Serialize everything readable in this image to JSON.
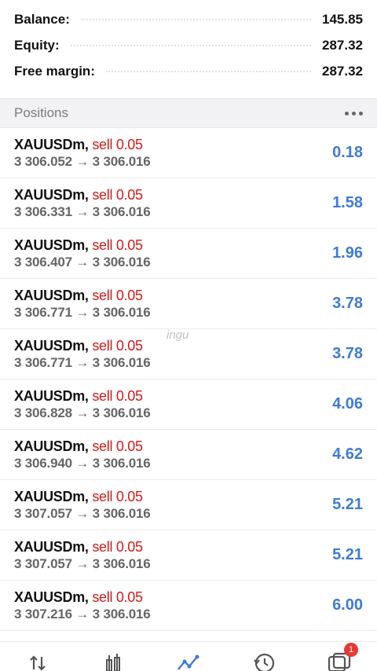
{
  "summary": [
    {
      "label": "Balance:",
      "value": "145.85"
    },
    {
      "label": "Equity:",
      "value": "287.32"
    },
    {
      "label": "Free margin:",
      "value": "287.32"
    }
  ],
  "positions_header": {
    "title": "Positions"
  },
  "positions": [
    {
      "symbol": "XAUUSDm,",
      "side": "sell 0.05",
      "prices": "3 306.052 → 3 306.016",
      "profit": "0.18"
    },
    {
      "symbol": "XAUUSDm,",
      "side": "sell 0.05",
      "prices": "3 306.331 → 3 306.016",
      "profit": "1.58"
    },
    {
      "symbol": "XAUUSDm,",
      "side": "sell 0.05",
      "prices": "3 306.407 → 3 306.016",
      "profit": "1.96"
    },
    {
      "symbol": "XAUUSDm,",
      "side": "sell 0.05",
      "prices": "3 306.771 → 3 306.016",
      "profit": "3.78"
    },
    {
      "symbol": "XAUUSDm,",
      "side": "sell 0.05",
      "prices": "3 306.771 → 3 306.016",
      "profit": "3.78"
    },
    {
      "symbol": "XAUUSDm,",
      "side": "sell 0.05",
      "prices": "3 306.828 → 3 306.016",
      "profit": "4.06"
    },
    {
      "symbol": "XAUUSDm,",
      "side": "sell 0.05",
      "prices": "3 306.940 → 3 306.016",
      "profit": "4.62"
    },
    {
      "symbol": "XAUUSDm,",
      "side": "sell 0.05",
      "prices": "3 307.057 → 3 306.016",
      "profit": "5.21"
    },
    {
      "symbol": "XAUUSDm,",
      "side": "sell 0.05",
      "prices": "3 307.057 → 3 306.016",
      "profit": "5.21"
    },
    {
      "symbol": "XAUUSDm,",
      "side": "sell 0.05",
      "prices": "3 307.216 → 3 306.016",
      "profit": "6.00"
    }
  ],
  "watermark": "ingu",
  "nav": {
    "items": [
      "quotes-icon",
      "chart-icon",
      "trade-icon",
      "history-icon",
      "messages-icon"
    ],
    "active_color": "#3f7bd6",
    "badge": "1"
  },
  "colors": {
    "profit": "#3f7bd6",
    "sell": "#d11a1a"
  }
}
